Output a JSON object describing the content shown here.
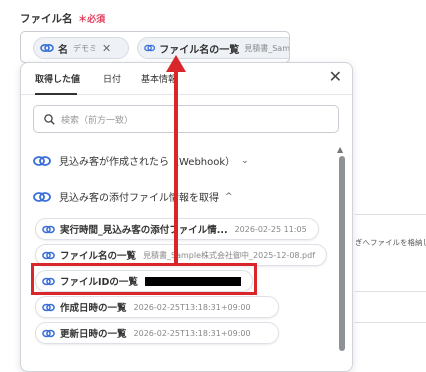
{
  "field": {
    "label": "ファイル名",
    "required": "＊必須",
    "tokens": [
      {
        "name": "名",
        "value": "デモミ",
        "remove": "✕"
      },
      {
        "name": "ファイル名の一覧",
        "value": "見積書_Sam"
      }
    ],
    "separator": "_"
  },
  "picker": {
    "tabs": [
      "取得した値",
      "日付",
      "基本情報"
    ],
    "close": "✕",
    "search_placeholder": "検索（前方一致）",
    "groups": [
      {
        "label": "見込み客が作成されたら（Webhook）",
        "chevron": "⌄"
      },
      {
        "label": "見込み客の添付ファイル情報を取得",
        "chevron": "^"
      }
    ],
    "items": [
      {
        "name": "実行時間_見込み客の添付ファイル情...",
        "value": "2026-02-25 11:05"
      },
      {
        "name": "ファイル名の一覧",
        "value": "見積書_Sample株式会社御中_2025-12-08.pdf"
      },
      {
        "name": "ファイルIDの一覧",
        "value": ""
      },
      {
        "name": "作成日時の一覧",
        "value": "2026-02-25T13:18:31+09:00"
      },
      {
        "name": "更新日時の一覧",
        "value": "2026-02-25T13:18:31+09:00"
      }
    ]
  },
  "background": {
    "hint": "ぎへファイルを格納しま"
  },
  "colors": {
    "accent_red": "#d8262b",
    "required": "#e23b5a",
    "link_icon": "#3a6fd8"
  },
  "icons": {
    "link": "link-icon",
    "search": "search-icon",
    "close": "close-icon"
  }
}
